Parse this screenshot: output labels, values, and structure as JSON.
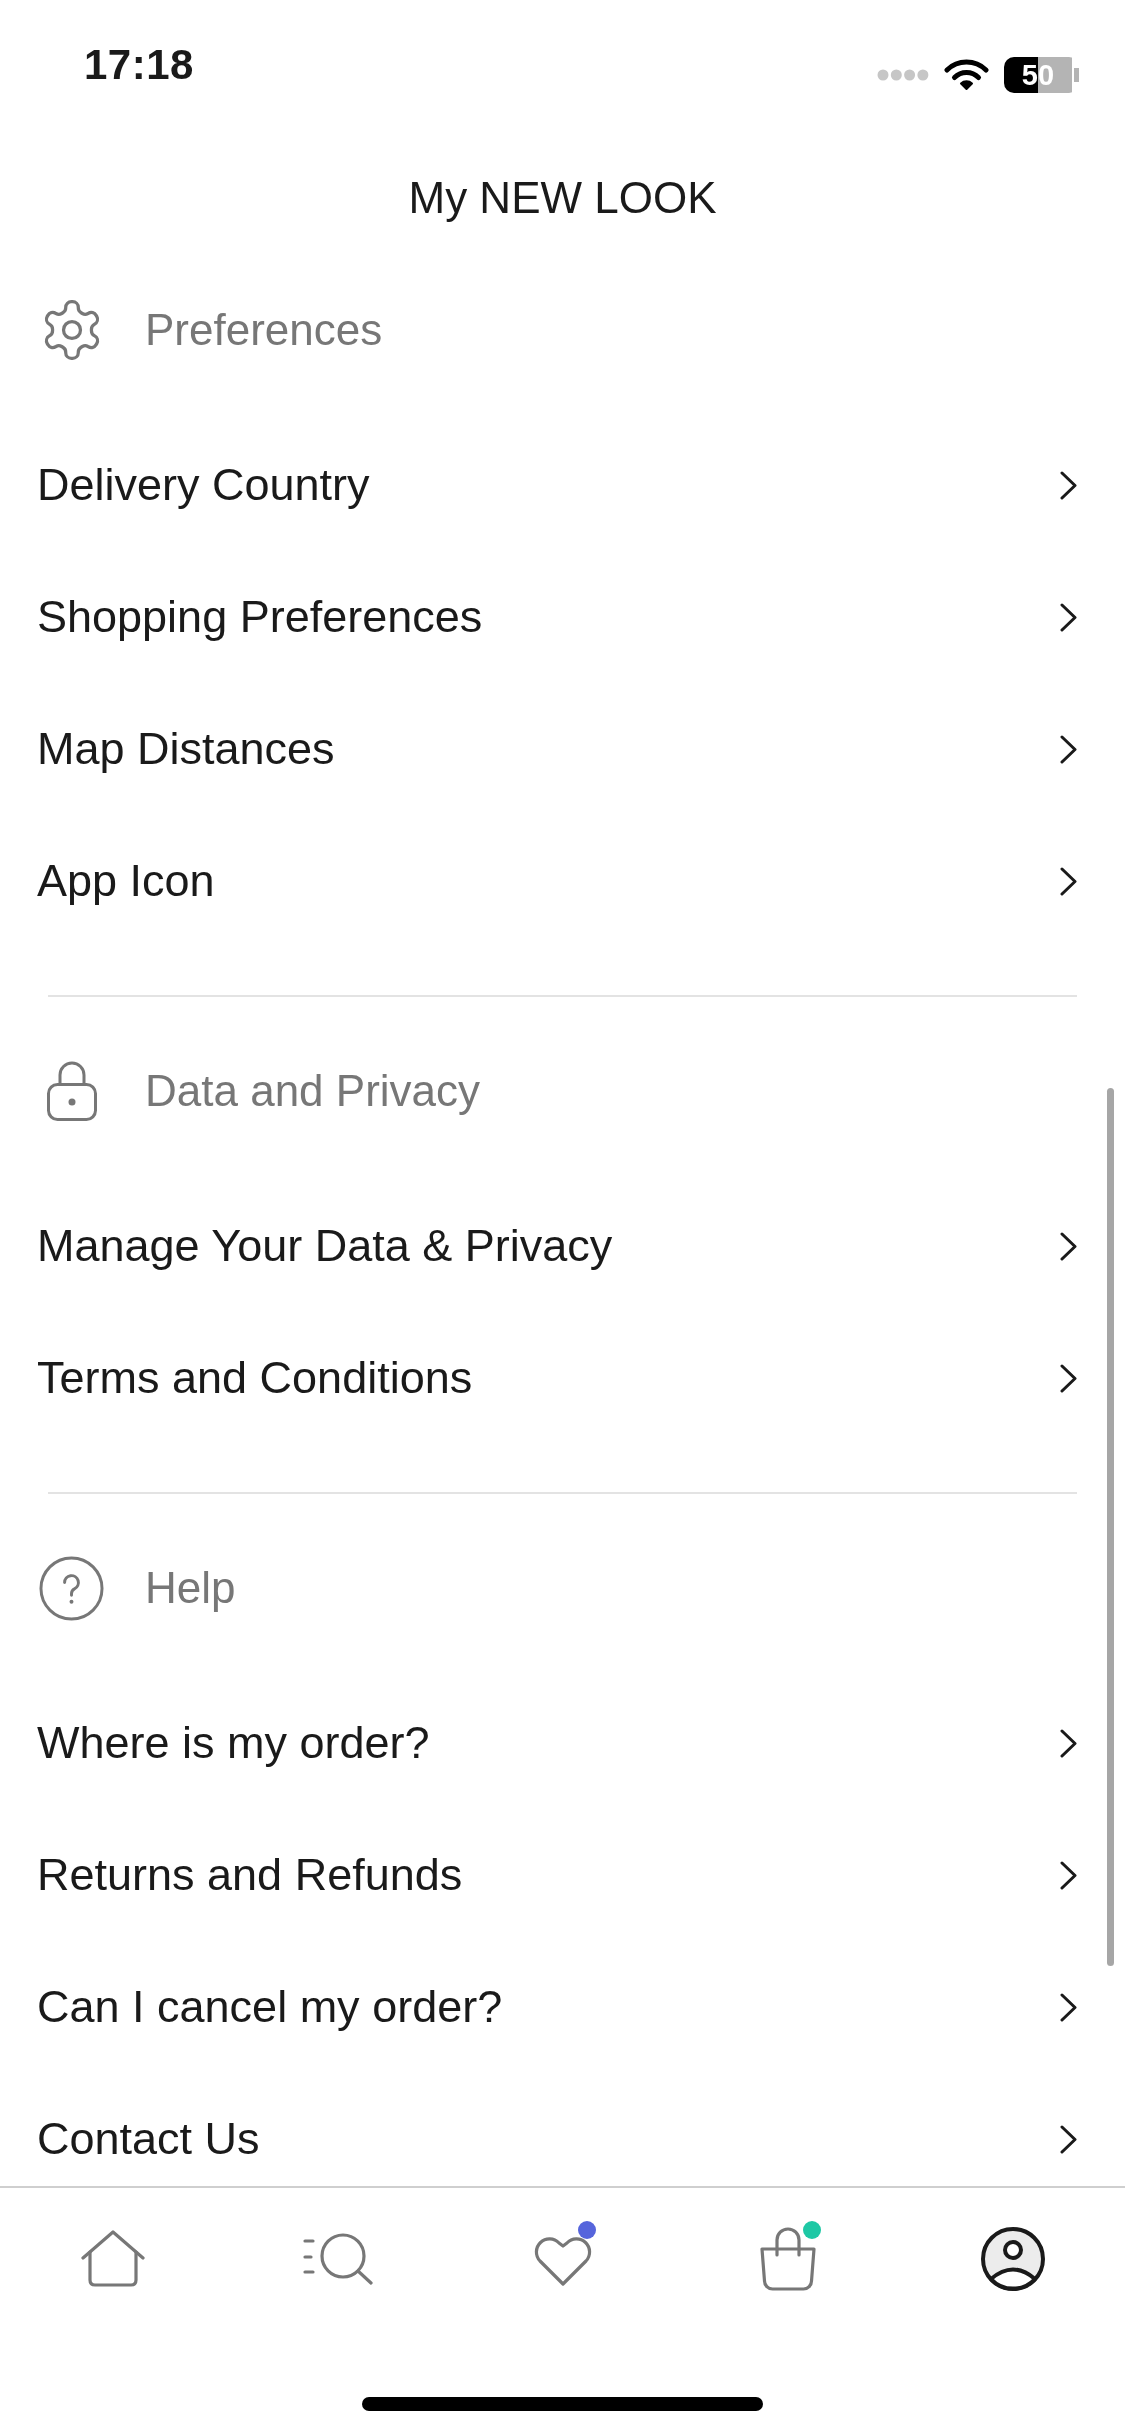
{
  "status_bar": {
    "time": "17:18",
    "battery": "50"
  },
  "title": "My NEW LOOK",
  "sections": [
    {
      "kind": "gear",
      "title": "Preferences",
      "items": [
        "Delivery Country",
        "Shopping Preferences",
        "Map Distances",
        "App Icon"
      ]
    },
    {
      "kind": "lock",
      "title": "Data and Privacy",
      "items": [
        "Manage Your Data & Privacy",
        "Terms and Conditions"
      ]
    },
    {
      "kind": "help",
      "title": "Help",
      "items": [
        "Where is my order?",
        "Returns and Refunds",
        "Can I cancel my order?",
        "Contact Us"
      ]
    }
  ],
  "tab_bar": [
    {
      "kind": "home",
      "selected": false
    },
    {
      "kind": "search",
      "selected": false
    },
    {
      "kind": "wishlist",
      "selected": false,
      "color": "#5665dc"
    },
    {
      "kind": "bag",
      "selected": false,
      "color": "#1ec8a5"
    },
    {
      "kind": "account",
      "selected": true
    }
  ]
}
